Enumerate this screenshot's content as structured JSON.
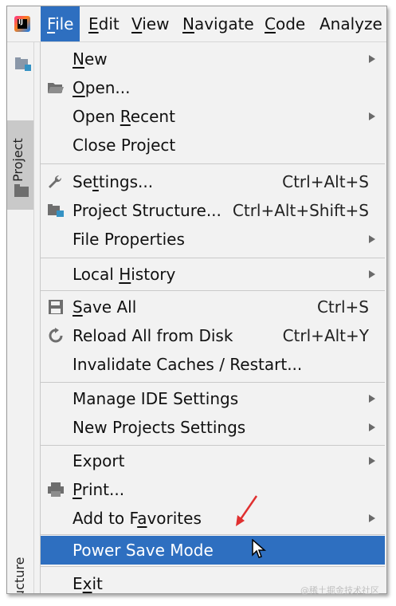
{
  "menubar": {
    "items": [
      {
        "label": "File",
        "mnemonic_label": "F",
        "rest": "ile"
      },
      {
        "label": "Edit",
        "mnemonic_label": "E",
        "rest": "dit"
      },
      {
        "label": "View",
        "mnemonic_label": "V",
        "rest": "iew"
      },
      {
        "label": "Navigate",
        "mnemonic_label": "N",
        "rest": "avigate"
      },
      {
        "label": "Code",
        "mnemonic_label": "C",
        "rest": "ode"
      },
      {
        "label": "Analyze",
        "mnemonic_label": "",
        "rest": "Analyze"
      }
    ],
    "active": "File"
  },
  "toolstrip": {
    "project_tab_label": "Project",
    "structure_tab_label": "Structure"
  },
  "file_menu": {
    "new": {
      "pre": "",
      "mn": "N",
      "post": "ew"
    },
    "open": {
      "pre": "",
      "mn": "O",
      "post": "pen..."
    },
    "open_recent": {
      "pre": "Open ",
      "mn": "R",
      "post": "ecent"
    },
    "close_project": {
      "label": "Close Project"
    },
    "settings": {
      "pre": "Se",
      "mn": "t",
      "post": "tings...",
      "shortcut": "Ctrl+Alt+S"
    },
    "project_structure": {
      "label": "Project Structure...",
      "shortcut": "Ctrl+Alt+Shift+S"
    },
    "file_properties": {
      "label": "File Properties"
    },
    "local_history": {
      "pre": "Local ",
      "mn": "H",
      "post": "istory"
    },
    "save_all": {
      "pre": "",
      "mn": "S",
      "post": "ave All",
      "shortcut": "Ctrl+S"
    },
    "reload_all": {
      "label": "Reload All from Disk",
      "shortcut": "Ctrl+Alt+Y"
    },
    "invalidate_caches": {
      "label": "Invalidate Caches / Restart..."
    },
    "manage_ide_settings": {
      "label": "Manage IDE Settings"
    },
    "new_projects_settings": {
      "label": "New Projects Settings"
    },
    "export": {
      "label": "Export"
    },
    "print": {
      "pre": "",
      "mn": "P",
      "post": "rint..."
    },
    "add_to_favorites": {
      "pre": "Add to F",
      "mn": "a",
      "post": "vorites"
    },
    "power_save_mode": {
      "label": "Power Save Mode"
    },
    "exit": {
      "pre": "E",
      "mn": "x",
      "post": "it"
    }
  },
  "watermark": "@稀土掘金技术社区",
  "colors": {
    "highlight": "#2e6fc0",
    "menu_bg": "#f2f2f2",
    "annotation_arrow": "#e03030"
  }
}
